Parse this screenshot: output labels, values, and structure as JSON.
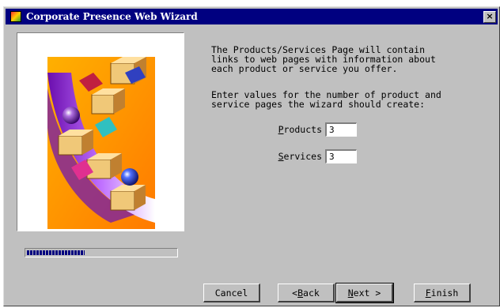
{
  "window": {
    "title": "Corporate Presence Web Wizard",
    "close_glyph": "×"
  },
  "description": {
    "paragraph1": "The Products/Services Page will contain\nlinks to web pages with information about\neach product or service you offer.",
    "paragraph2": "Enter values for the number of product and\nservice pages the wizard should create:"
  },
  "fields": {
    "products": {
      "label_first": "P",
      "label_rest": "roducts",
      "value": "3"
    },
    "services": {
      "label_first": "S",
      "label_rest": "ervices",
      "value": "3"
    }
  },
  "progress": {
    "fraction": 0.38
  },
  "buttons": {
    "cancel": "Cancel",
    "back_prefix": "< ",
    "back_first": "B",
    "back_rest": "ack",
    "next_first": "N",
    "next_rest": "ext >",
    "finish_first": "F",
    "finish_rest": "inish"
  },
  "colors": {
    "titlebar": "#000080",
    "face": "#c0c0c0",
    "illustration_bg": "#ff9a00",
    "illustration_arc": "#8a2be2"
  }
}
